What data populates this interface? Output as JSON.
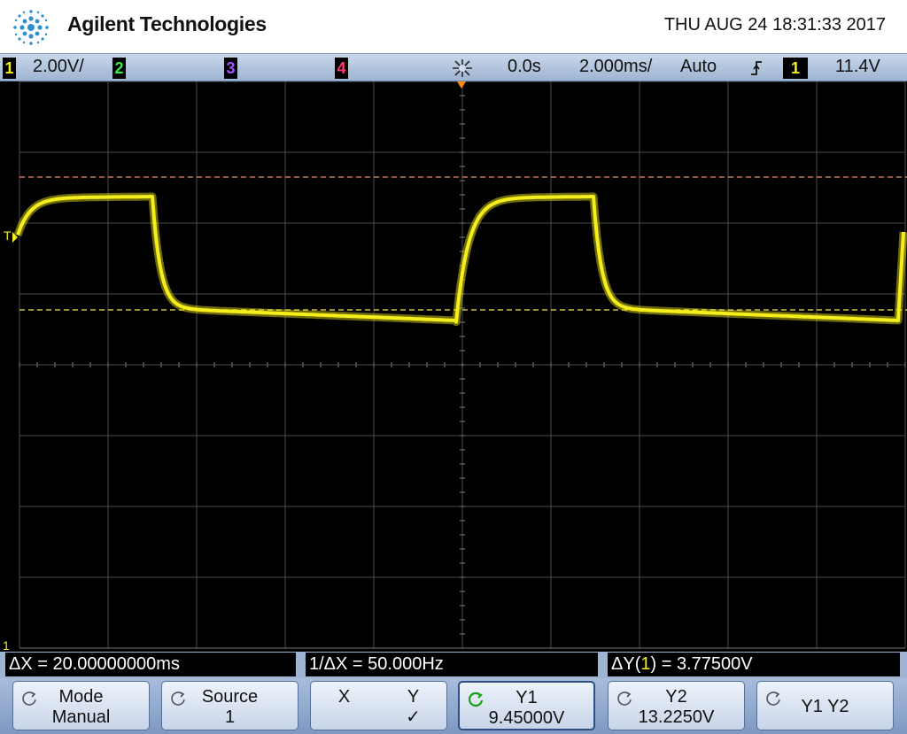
{
  "header": {
    "brand": "Agilent Technologies",
    "datetime": "THU AUG 24 18:31:33 2017"
  },
  "status": {
    "ch1_num": "1",
    "ch1_scale": "2.00V/",
    "ch2_num": "2",
    "ch3_num": "3",
    "ch4_num": "4",
    "time_delay": "0.0s",
    "time_scale": "2.000ms/",
    "trigger_mode": "Auto",
    "trigger_source": "1",
    "trigger_level": "11.4V"
  },
  "screen": {
    "trigger_marker": "T",
    "ground_marker": "1"
  },
  "measurements": {
    "delta_x": "ΔX = 20.00000000ms",
    "inv_delta_x": "1/ΔX = 50.000Hz",
    "delta_y_prefix": "ΔY(",
    "delta_y_channel": "1",
    "delta_y_suffix": ") = 3.77500V"
  },
  "softkeys": {
    "mode_label": "Mode",
    "mode_value": "Manual",
    "source_label": "Source",
    "source_value": "1",
    "x_label": "X",
    "y_label": "Y",
    "y_check": "✓",
    "y1_label": "Y1",
    "y1_value": "9.45000V",
    "y2_label": "Y2",
    "y2_value": "13.2250V",
    "y1y2_label": "Y1 Y2"
  },
  "colors": {
    "ch1": "#f5ee1a",
    "ch2": "#3ee84a",
    "ch3": "#a452ff",
    "ch4": "#ff3a7a",
    "cursor_y1": "#f5e64a",
    "cursor_y2": "#f58a6e"
  }
}
